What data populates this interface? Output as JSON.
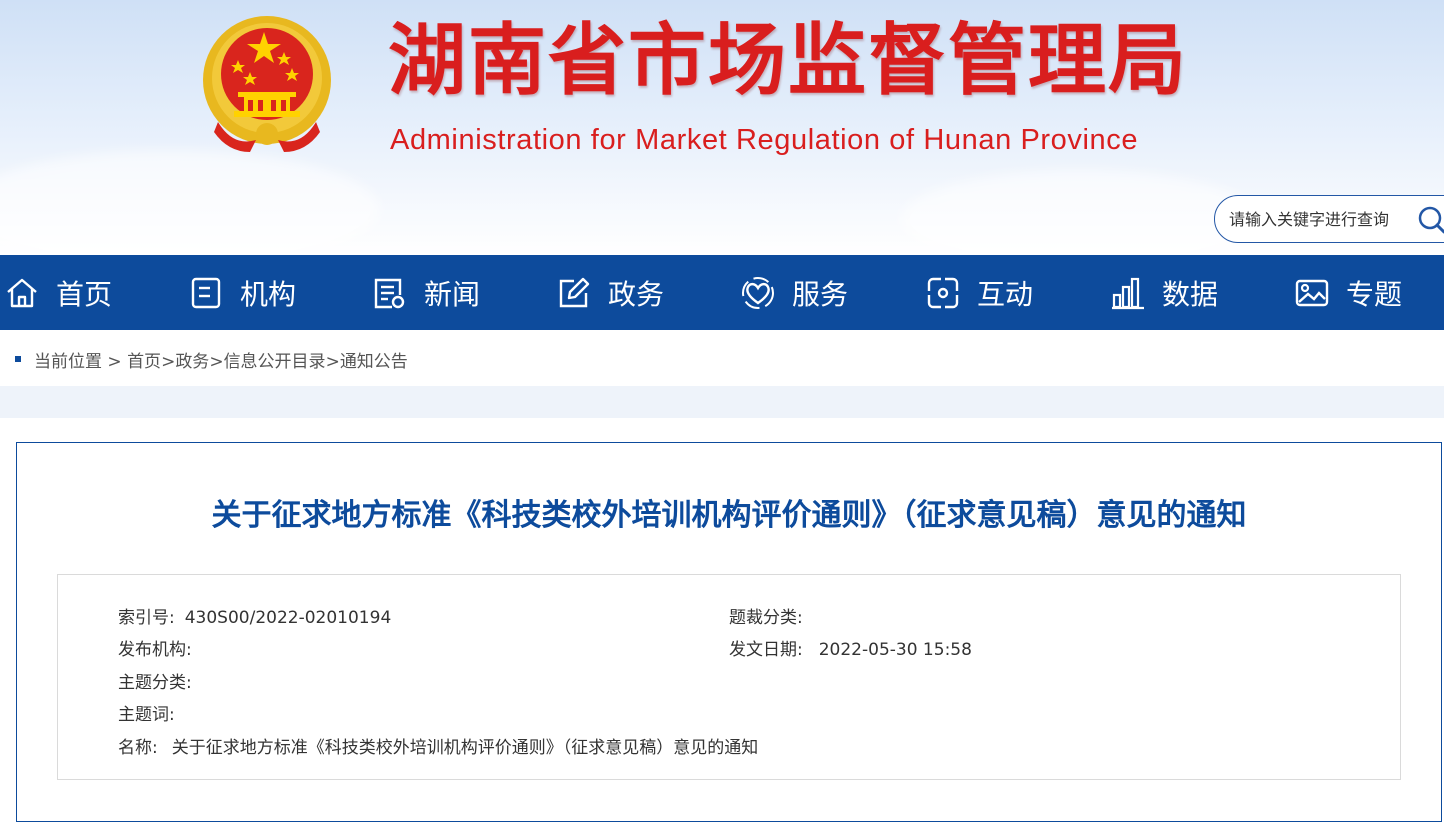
{
  "site": {
    "title": "湖南省市场监督管理局",
    "subtitle": "Administration for Market Regulation of Hunan Province",
    "emblem": "national-emblem"
  },
  "search": {
    "placeholder": "请输入关键字进行查询",
    "icon": "search-icon"
  },
  "nav": [
    {
      "label": "首页",
      "icon": "home-icon"
    },
    {
      "label": "机构",
      "icon": "document-icon"
    },
    {
      "label": "新闻",
      "icon": "news-icon"
    },
    {
      "label": "政务",
      "icon": "edit-icon"
    },
    {
      "label": "服务",
      "icon": "service-heart-icon"
    },
    {
      "label": "互动",
      "icon": "interaction-icon"
    },
    {
      "label": "数据",
      "icon": "bar-chart-icon"
    },
    {
      "label": "专题",
      "icon": "image-icon"
    }
  ],
  "breadcrumb": {
    "prefix": "当前位置 >",
    "items": [
      "首页",
      "政务",
      "信息公开目录",
      "通知公告"
    ],
    "sep": ">"
  },
  "article": {
    "title": "关于征求地方标准《科技类校外培训机构评价通则》（征求意见稿）意见的通知",
    "meta": {
      "index_label": "索引号:",
      "index_value": "430S00/2022-02010194",
      "genre_label": "题裁分类:",
      "genre_value": "",
      "publisher_label": "发布机构:",
      "publisher_value": "",
      "date_label": "发文日期:",
      "date_value": "2022-05-30 15:58",
      "topic_label": "主题分类:",
      "topic_value": "",
      "keyword_label": "主题词:",
      "keyword_value": "",
      "name_label": "名称:",
      "name_value": "关于征求地方标准《科技类校外培训机构评价通则》（征求意见稿）意见的通知"
    }
  },
  "colors": {
    "brand_red": "#d91e1e",
    "nav_blue": "#0d4b9c",
    "title_blue": "#0d4b9c"
  }
}
